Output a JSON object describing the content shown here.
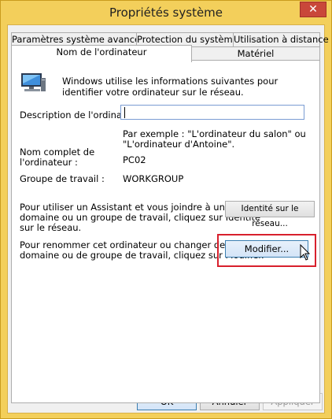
{
  "window": {
    "title": "Propriétés système",
    "close_glyph": "✕"
  },
  "tabs": {
    "row1": [
      "Paramètres système avancés",
      "Protection du système",
      "Utilisation à distance"
    ],
    "row2": [
      "Nom de l'ordinateur",
      "Matériel"
    ]
  },
  "intro": "Windows utilise les informations suivantes pour identifier votre ordinateur sur le réseau.",
  "description": {
    "label": "Description de l'ordinateur :",
    "value": "",
    "example_line1": "Par exemple : \"L'ordinateur du salon\" ou",
    "example_line2": "\"L'ordinateur d'Antoine\"."
  },
  "full_name": {
    "label_line1": "Nom complet de",
    "label_line2": "l'ordinateur :",
    "value": "PC02"
  },
  "workgroup": {
    "label": "Groupe de travail :",
    "value": "WORKGROUP"
  },
  "network_id": {
    "text_line1": "Pour utiliser un Assistant et vous joindre à un",
    "text_line2": "domaine ou un groupe de travail, cliquez sur Identité",
    "text_line3": "sur le réseau.",
    "button": "Identité sur le réseau..."
  },
  "rename": {
    "text_line1": "Pour renommer cet ordinateur ou changer de",
    "text_line2": "domaine ou de groupe de travail, cliquez sur Modifier.",
    "button": "Modifier..."
  },
  "footer": {
    "ok": "OK",
    "cancel": "Annuler",
    "apply": "Appliquer"
  }
}
